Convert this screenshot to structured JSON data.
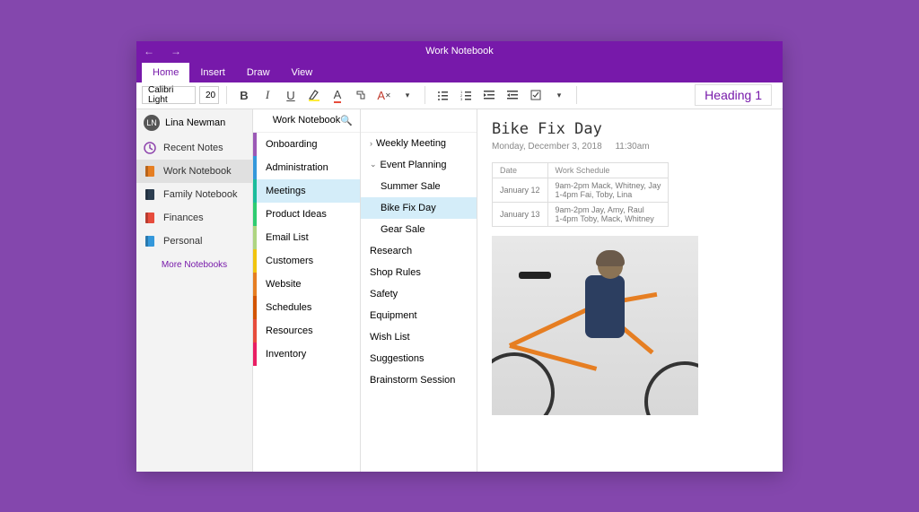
{
  "window_title": "Work Notebook",
  "tabs": [
    "Home",
    "Insert",
    "Draw",
    "View"
  ],
  "active_tab": 0,
  "ribbon": {
    "font_name": "Calibri Light",
    "font_size": "20",
    "heading_label": "Heading 1"
  },
  "user": {
    "initials": "LN",
    "name": "Lina Newman"
  },
  "sidebar": {
    "items": [
      {
        "label": "Recent Notes",
        "icon": "clock",
        "color": "#8e44ad"
      },
      {
        "label": "Work Notebook",
        "icon": "notebook",
        "color": "#e67e22",
        "selected": true
      },
      {
        "label": "Family Notebook",
        "icon": "notebook",
        "color": "#2c3e50"
      },
      {
        "label": "Finances",
        "icon": "notebook",
        "color": "#e74c3c"
      },
      {
        "label": "Personal",
        "icon": "notebook",
        "color": "#3498db"
      }
    ],
    "more_label": "More Notebooks"
  },
  "sections_header": "Work Notebook",
  "sections": [
    {
      "label": "Onboarding",
      "color": "c-purple"
    },
    {
      "label": "Administration",
      "color": "c-blue"
    },
    {
      "label": "Meetings",
      "color": "c-teal",
      "selected": true
    },
    {
      "label": "Product Ideas",
      "color": "c-green"
    },
    {
      "label": "Email List",
      "color": "c-lime"
    },
    {
      "label": "Customers",
      "color": "c-yellow"
    },
    {
      "label": "Website",
      "color": "c-orange"
    },
    {
      "label": "Schedules",
      "color": "c-darkorange"
    },
    {
      "label": "Resources",
      "color": "c-red"
    },
    {
      "label": "Inventory",
      "color": "c-pink"
    }
  ],
  "pages": [
    {
      "label": "Weekly Meeting",
      "chev": "right"
    },
    {
      "label": "Event Planning",
      "chev": "down"
    },
    {
      "label": "Summer Sale",
      "indent": true
    },
    {
      "label": "Bike Fix Day",
      "indent": true,
      "selected": true
    },
    {
      "label": "Gear Sale",
      "indent": true
    },
    {
      "label": "Research"
    },
    {
      "label": "Shop Rules"
    },
    {
      "label": "Safety"
    },
    {
      "label": "Equipment"
    },
    {
      "label": "Wish List"
    },
    {
      "label": "Suggestions"
    },
    {
      "label": "Brainstorm Session"
    }
  ],
  "content": {
    "title": "Bike Fix Day",
    "date": "Monday, December 3, 2018",
    "time": "11:30am",
    "table": {
      "headers": [
        "Date",
        "Work Schedule"
      ],
      "rows": [
        [
          "January 12",
          "9am-2pm Mack, Whitney, Jay\n1-4pm Fai, Toby, Lina"
        ],
        [
          "January 13",
          "9am-2pm Jay, Amy, Raul\n1-4pm Toby, Mack, Whitney"
        ]
      ]
    }
  }
}
